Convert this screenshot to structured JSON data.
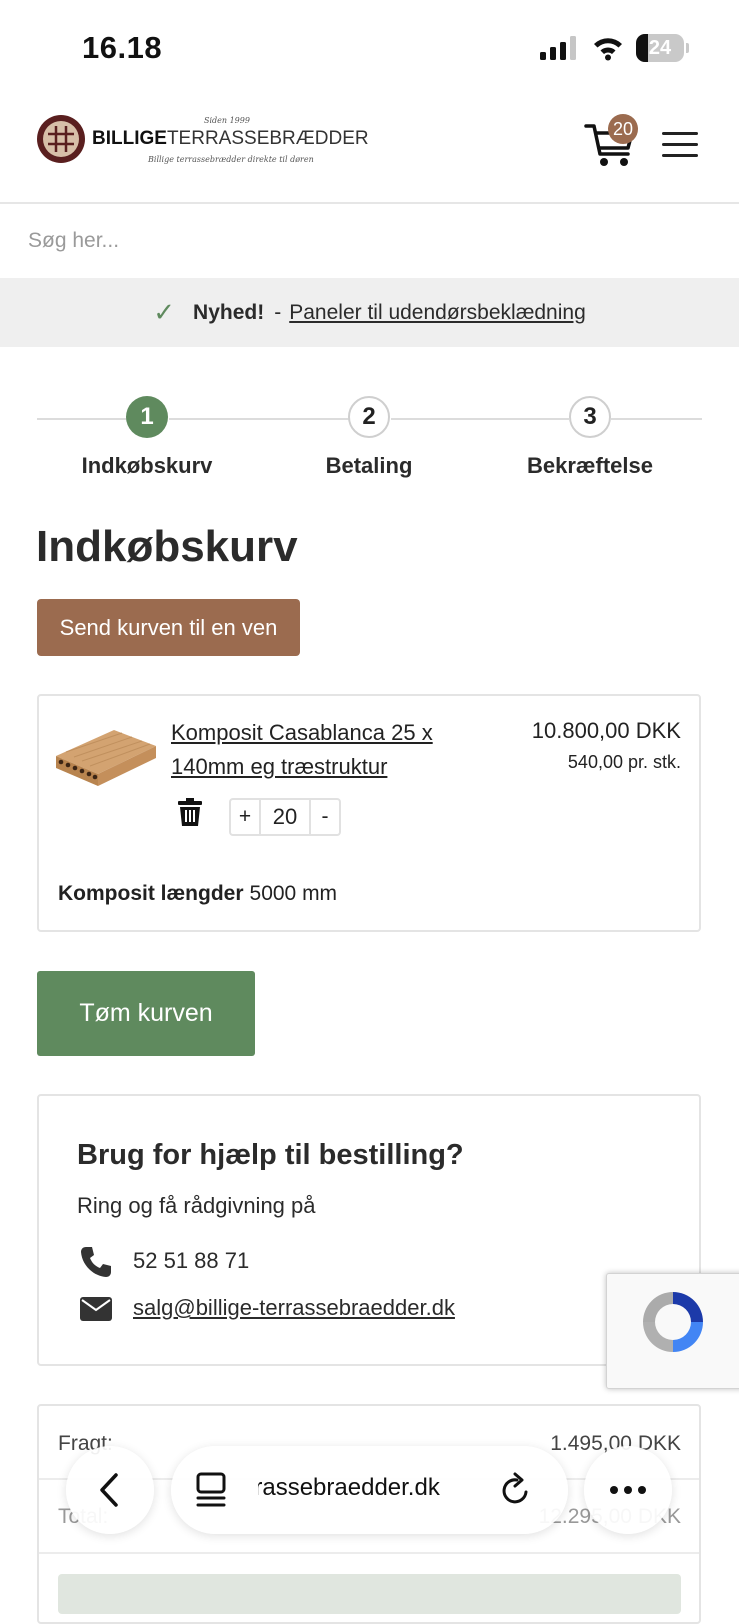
{
  "status_bar": {
    "time": "16.18",
    "battery": "24"
  },
  "header": {
    "logo_since": "Siden 1999",
    "logo_bold": "BILLIGE",
    "logo_light": "TERRASSEBRÆDDER",
    "logo_tagline": "Billige terrassebrædder direkte til døren",
    "cart_count": "20",
    "brand_color": "#9b6b4f",
    "icons": [
      "cart-icon",
      "menu-icon"
    ]
  },
  "search": {
    "placeholder": "Søg her..."
  },
  "news": {
    "label": "Nyhed!",
    "separator": "-",
    "link": "Paneler til udendørsbeklædning"
  },
  "steps": [
    {
      "num": "1",
      "label": "Indkøbskurv",
      "active": true
    },
    {
      "num": "2",
      "label": "Betaling",
      "active": false
    },
    {
      "num": "3",
      "label": "Bekræftelse",
      "active": false
    }
  ],
  "page_title": "Indkøbskurv",
  "send_button": "Send kurven til en ven",
  "cart_item": {
    "title": "Komposit Casablanca 25 x 140mm eg træstruktur",
    "total": "10.800,00 DKK",
    "unit_price": "540,00 pr. stk.",
    "qty_plus": "+",
    "qty": "20",
    "qty_minus": "-",
    "attr_label": "Komposit længder",
    "attr_value": "5000 mm"
  },
  "empty_button": "Tøm kurven",
  "help": {
    "title": "Brug for hjælp til bestilling?",
    "subtitle": "Ring og få rådgivning på",
    "phone": "52 51 88 71",
    "email": "salg@billige-terrassebraedder.dk"
  },
  "summary": {
    "freight_label": "Fragt:",
    "freight_value": "1.495,00 DKK",
    "total_label": "Total:",
    "total_value": "12.295,00 DKK"
  },
  "browser": {
    "url": "billige-terrassebraedder.dk",
    "accent_green": "#5f8a5e"
  }
}
